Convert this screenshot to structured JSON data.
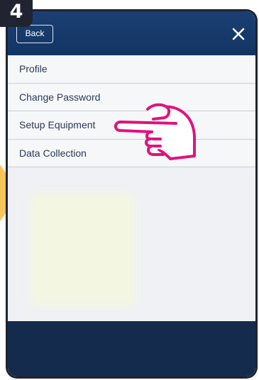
{
  "step_badge": "4",
  "header": {
    "back_label": "Back",
    "close_icon": "close-icon"
  },
  "menu": {
    "items": [
      {
        "label": "Profile"
      },
      {
        "label": "Change Password"
      },
      {
        "label": "Setup Equipment"
      },
      {
        "label": "Data Collection"
      }
    ]
  },
  "annotation": {
    "pointer_icon": "hand-pointer-icon",
    "pointer_color": "#e0127e",
    "arrow_color": "#f7c55a"
  },
  "colors": {
    "header_bg": "#1b3f73",
    "footer_bg": "#152b4d",
    "menu_text": "#2b3a55"
  }
}
